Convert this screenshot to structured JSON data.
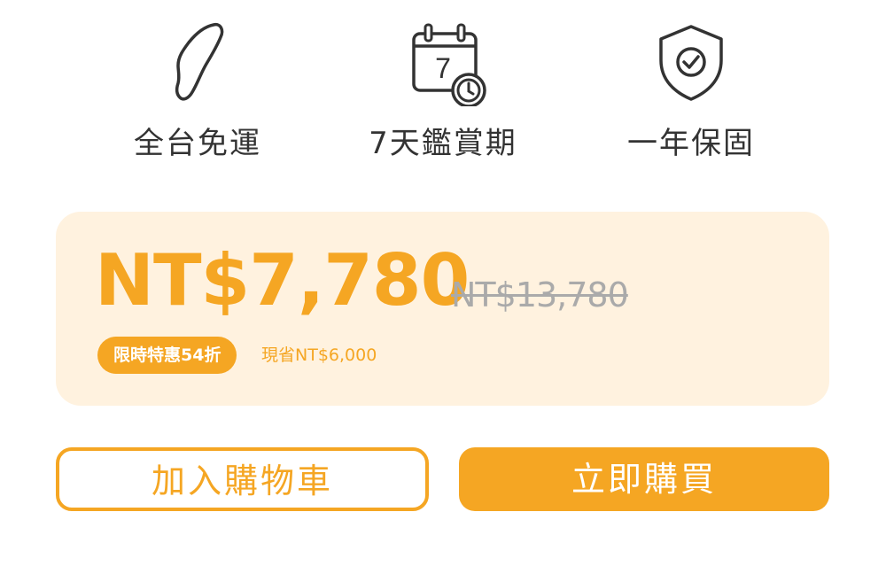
{
  "colors": {
    "accent": "#f5a623",
    "panel": "#fff2df",
    "text": "#333333",
    "muted": "#aaaaaa"
  },
  "features": [
    {
      "icon": "taiwan-map-icon",
      "label": "全台免運"
    },
    {
      "icon": "calendar-clock-icon",
      "label": "7天鑑賞期",
      "icon_text": "7"
    },
    {
      "icon": "shield-check-icon",
      "label": "一年保固"
    }
  ],
  "pricing": {
    "current_price": "NT$7,780",
    "original_price": "NT$13,780",
    "discount_badge": "限時特惠54折",
    "savings": "現省NT$6,000"
  },
  "actions": {
    "add_to_cart": "加入購物車",
    "buy_now": "立即購買"
  }
}
